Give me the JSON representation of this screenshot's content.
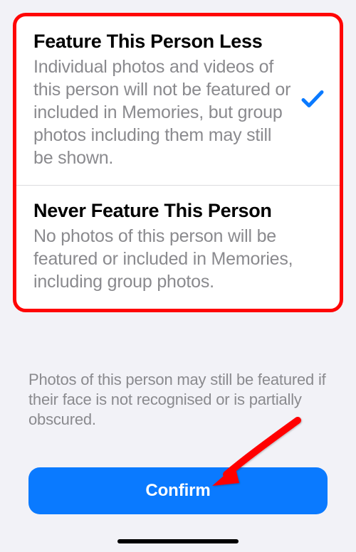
{
  "options": [
    {
      "title": "Feature This Person Less",
      "description": "Individual photos and videos of this person will not be featured or included in Memories, but group photos including them may still be shown.",
      "selected": true
    },
    {
      "title": "Never Feature This Person",
      "description": "No photos of this person will be featured or included in Memories, including group photos.",
      "selected": false
    }
  ],
  "disclaimer": "Photos of this person may still be featured if their face is not recognised or is partially obscured.",
  "confirm_label": "Confirm",
  "colors": {
    "accent": "#0a7aff",
    "annotation": "#ff0505"
  }
}
